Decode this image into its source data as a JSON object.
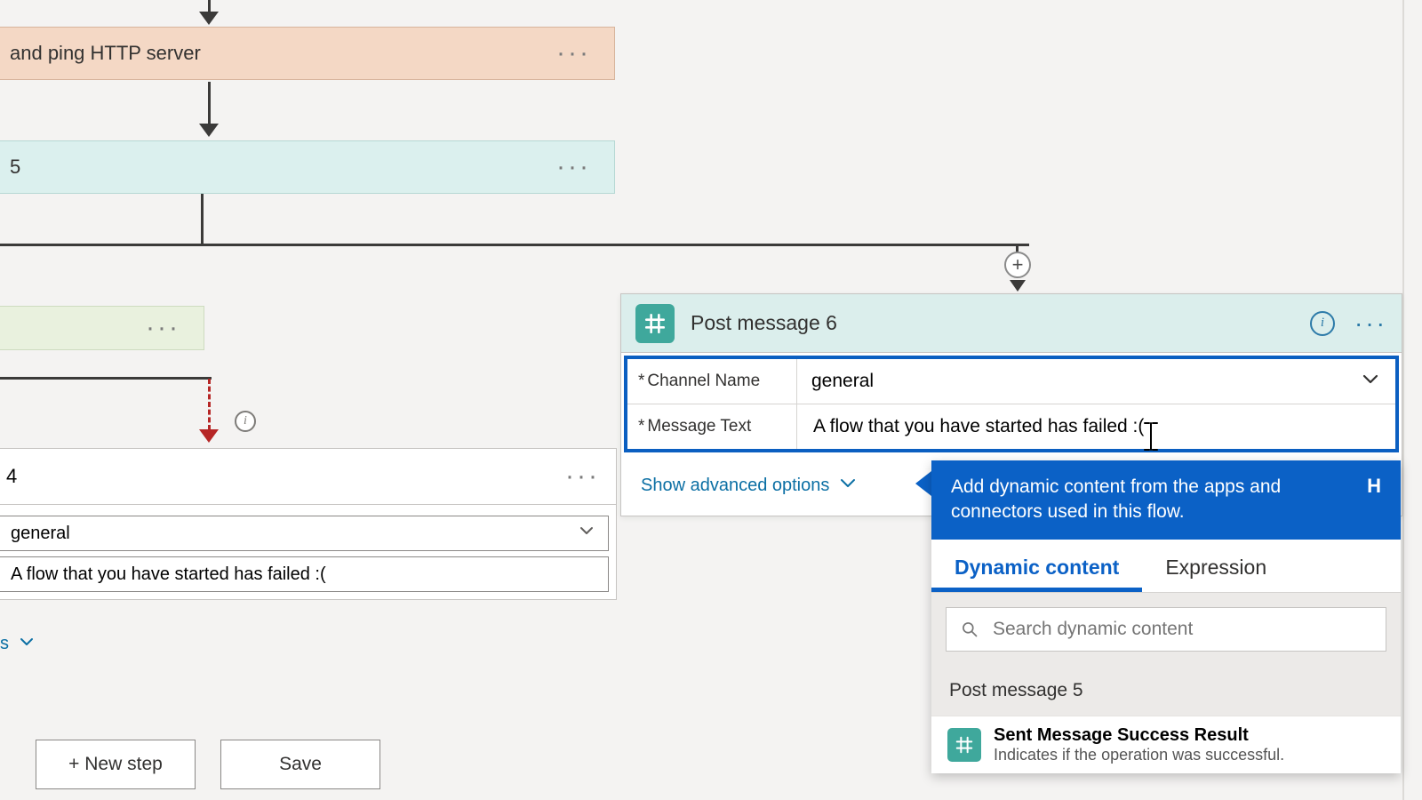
{
  "nodes": {
    "http": "and ping HTTP server",
    "five": "5",
    "four": "4"
  },
  "collapsed_card": {
    "channel_value": "general",
    "message_value": "A flow that you have started has failed :("
  },
  "buttons": {
    "new_step": "+ New step",
    "save": "Save"
  },
  "editor": {
    "title": "Post message 6",
    "channel_label": "Channel Name",
    "channel_value": "general",
    "message_label": "Message Text",
    "message_value": "A flow that you have started has failed :(",
    "advanced": "Show advanced options"
  },
  "popover": {
    "banner": "Add dynamic content from the apps and connectors used in this flow.",
    "hide": "H",
    "tab_dynamic": "Dynamic content",
    "tab_expression": "Expression",
    "search_placeholder": "Search dynamic content",
    "section": "Post message 5",
    "item_title": "Sent Message Success Result",
    "item_desc": "Indicates if the operation was successful."
  }
}
